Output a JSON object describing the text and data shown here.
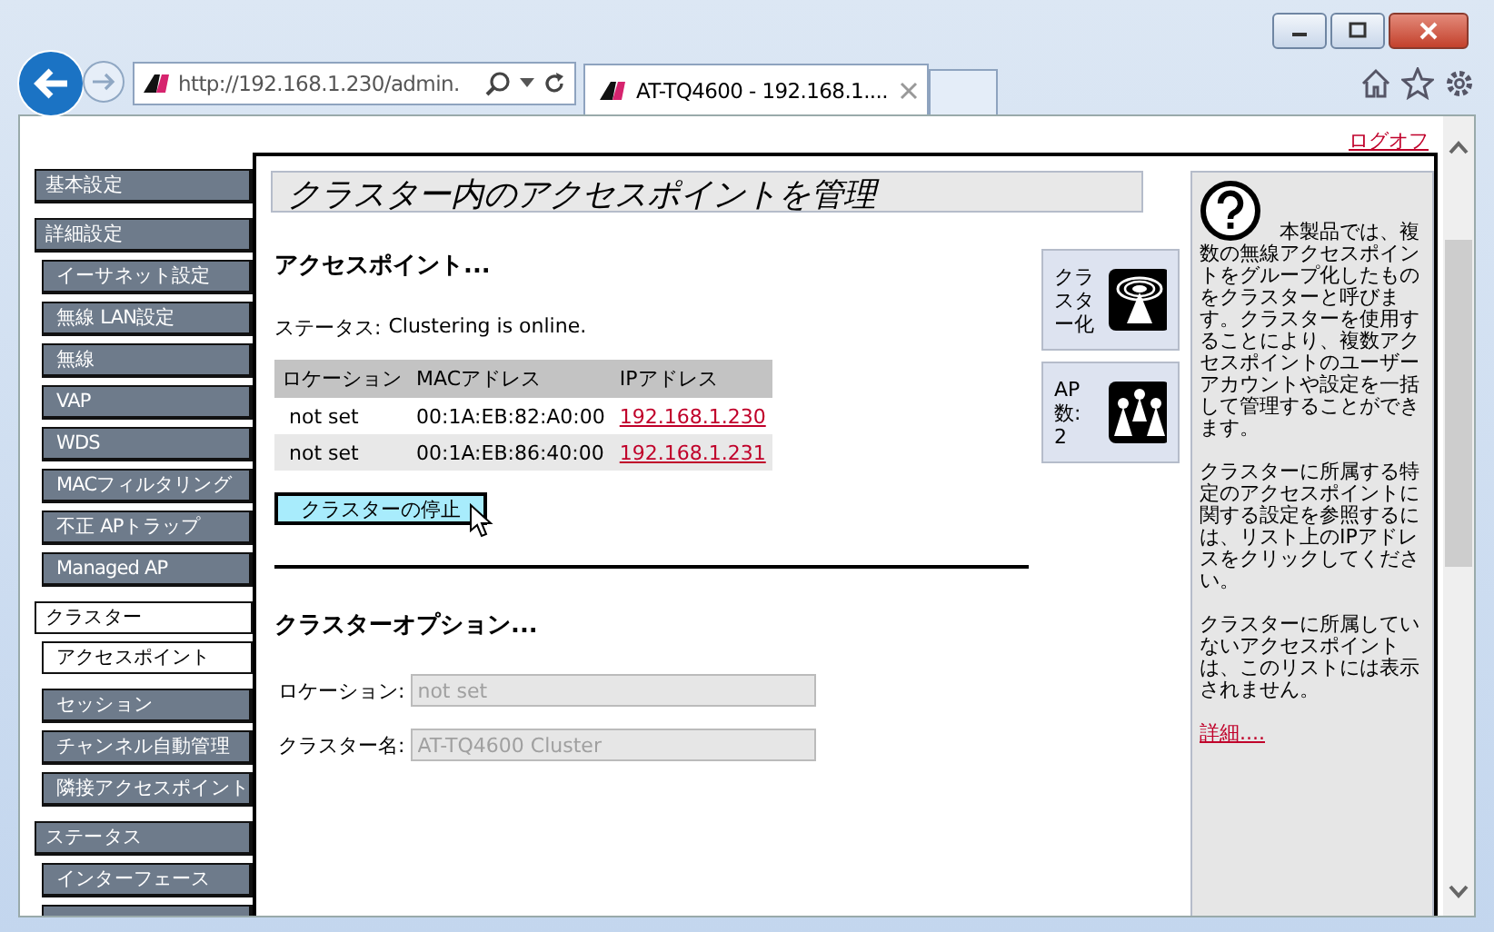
{
  "browser": {
    "address": "http://192.168.1.230/admin.",
    "tab_title": "AT-TQ4600 - 192.168.1...."
  },
  "logoff": "ログオフ",
  "sidebar": [
    {
      "items": [
        {
          "label": "基本設定",
          "kind": "header",
          "selected": false
        }
      ]
    },
    {
      "items": [
        {
          "label": "詳細設定",
          "kind": "header",
          "selected": false
        },
        {
          "label": "イーサネット設定",
          "kind": "sub",
          "selected": false
        },
        {
          "label": "無線 LAN設定",
          "kind": "sub",
          "selected": false
        },
        {
          "label": "無線",
          "kind": "sub",
          "selected": false
        },
        {
          "label": "VAP",
          "kind": "sub",
          "selected": false
        },
        {
          "label": "WDS",
          "kind": "sub",
          "selected": false
        },
        {
          "label": "MACフィルタリング",
          "kind": "sub",
          "selected": false
        },
        {
          "label": "不正 APトラップ",
          "kind": "sub",
          "selected": false
        },
        {
          "label": "Managed AP",
          "kind": "sub",
          "selected": false
        }
      ]
    },
    {
      "items": [
        {
          "label": "クラスター",
          "kind": "header",
          "selected": true
        },
        {
          "label": "アクセスポイント",
          "kind": "sub",
          "selected": true
        }
      ]
    },
    {
      "items": [
        {
          "label": "セッション",
          "kind": "sub",
          "selected": false
        },
        {
          "label": "チャンネル自動管理",
          "kind": "sub",
          "selected": false
        },
        {
          "label": "隣接アクセスポイント",
          "kind": "sub",
          "selected": false
        }
      ]
    },
    {
      "items": [
        {
          "label": "ステータス",
          "kind": "header",
          "selected": false
        },
        {
          "label": "インターフェース",
          "kind": "sub",
          "selected": false
        },
        {
          "kind": "sub",
          "selected": false
        }
      ]
    }
  ],
  "page_title": "クラスター内のアクセスポイントを管理",
  "section1": {
    "heading": "アクセスポイント...",
    "status_label": "ステータス:",
    "status": "Clustering is online."
  },
  "table": {
    "columns": [
      "ロケーション",
      "MACアドレス",
      "IPアドレス"
    ],
    "rows": [
      {
        "location": "not set",
        "mac": "00:1A:EB:82:A0:00",
        "ip": "192.168.1.230"
      },
      {
        "location": "not set",
        "mac": "00:1A:EB:86:40:00",
        "ip": "192.168.1.231"
      }
    ]
  },
  "stop_button": "クラスターの停止",
  "section2": {
    "heading": "クラスターオプション...",
    "fields": [
      {
        "label": "ロケーション:",
        "value": "not set",
        "disabled": true
      },
      {
        "label": "クラスター名:",
        "value": "AT-TQ4600 Cluster",
        "disabled": true
      }
    ]
  },
  "cards": [
    {
      "kind": "cluster",
      "label": "クラスター化"
    },
    {
      "kind": "count",
      "label": "AP数:",
      "value": "2"
    }
  ],
  "help": {
    "paragraphs": [
      "本製品では、複数の無線アクセスポイントをグループ化したものをクラスターと呼びます。クラスターを使用することにより、複数アクセスポイントのユーザーアカウントや設定を一括して管理することができます。",
      "クラスターに所属する特定のアクセスポイントに関する設定を参照するには、リスト上のIPアドレスをクリックしてください。",
      "クラスターに所属していないアクセスポイントは、このリストには表示されません。"
    ],
    "link": "詳細...."
  }
}
